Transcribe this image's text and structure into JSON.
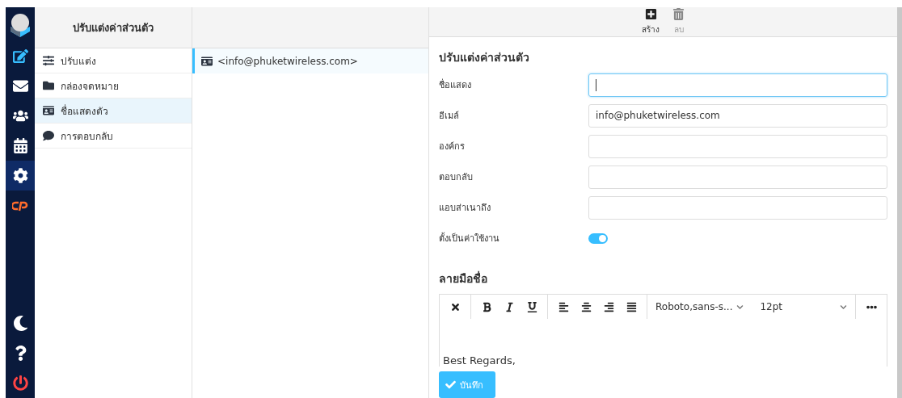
{
  "rail": {
    "items": [
      {
        "kind": "compose",
        "selected": false
      },
      {
        "kind": "mail",
        "selected": false
      },
      {
        "kind": "contacts",
        "selected": false
      },
      {
        "kind": "calendar",
        "selected": false
      },
      {
        "kind": "settings",
        "selected": true
      },
      {
        "kind": "cpanel",
        "selected": false
      }
    ],
    "bottom": [
      {
        "kind": "moon"
      },
      {
        "kind": "help"
      },
      {
        "kind": "power"
      }
    ]
  },
  "settings": {
    "title": "ปรับแต่งค่าส่วนตัว",
    "items": [
      {
        "label": "ปรับแต่ง",
        "kind": "sliders",
        "selected": false
      },
      {
        "label": "กล่องจดหมาย",
        "kind": "folder",
        "selected": false
      },
      {
        "label": "ชื่อแสดงตัว",
        "kind": "idcard",
        "selected": true
      },
      {
        "label": "การตอบกลับ",
        "kind": "comment",
        "selected": false
      }
    ]
  },
  "identities": [
    {
      "label": "<info@phuketwireless.com>",
      "selected": true
    }
  ],
  "toolbar": [
    {
      "label": "สร้าง",
      "kind": "create",
      "disabled": false
    },
    {
      "label": "ลบ",
      "kind": "delete",
      "disabled": true
    }
  ],
  "form": {
    "title": "ปรับแต่งค่าส่วนตัว",
    "fields": [
      {
        "label": "ชื่อแสดง",
        "focused": true
      },
      {
        "label": "อีเมล์",
        "value": "info@phuketwireless.com",
        "focused": false
      },
      {
        "label": "องค์กร",
        "focused": false
      },
      {
        "label": "ตอบกลับ",
        "focused": false
      },
      {
        "label": "แอบส่าเนาถึง",
        "focused": false
      }
    ],
    "toggle": {
      "label": "ตั้งเป็นค่าใช้งาน",
      "on": true
    },
    "signature": {
      "title": "ลายมือชื่อ",
      "font": "Roboto,sans-s...",
      "size": "12pt",
      "content": "Best Regards,"
    },
    "save": "บันทึก"
  }
}
